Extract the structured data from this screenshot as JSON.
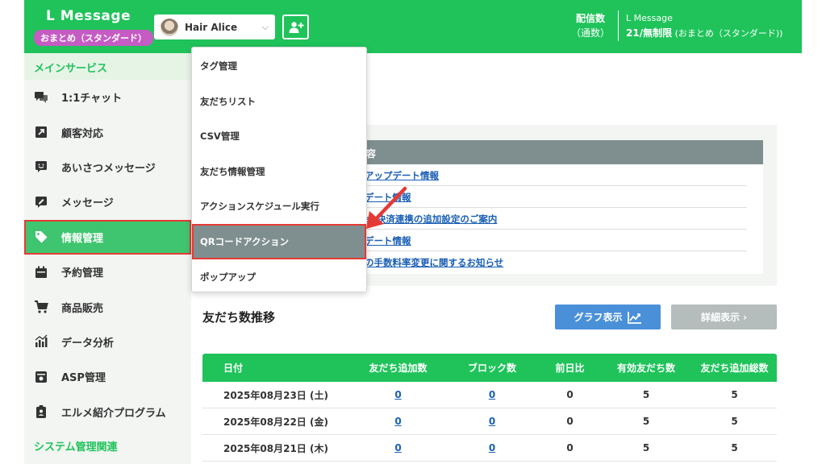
{
  "header": {
    "brand": "L Message",
    "plan_badge": "おまとめ（スタンダード）",
    "account_name": "Hair Alice",
    "delivery_label": "配信数",
    "delivery_sub": "（通数）",
    "plan_name": "L Message",
    "plan_quota": "21/無制限",
    "plan_type": " (おまとめ（スタンダード))"
  },
  "sidebar": {
    "section_main": "メインサービス",
    "items": [
      {
        "label": "1:1チャット",
        "icon": "chat-icon"
      },
      {
        "label": "顧客対応",
        "icon": "external-link-icon"
      },
      {
        "label": "あいさつメッセージ",
        "icon": "smile-message-icon"
      },
      {
        "label": "メッセージ",
        "icon": "message-edit-icon"
      },
      {
        "label": "情報管理",
        "icon": "tag-icon"
      },
      {
        "label": "予約管理",
        "icon": "calendar-icon"
      },
      {
        "label": "商品販売",
        "icon": "cart-icon"
      },
      {
        "label": "データ分析",
        "icon": "bar-chart-icon"
      },
      {
        "label": "ASP管理",
        "icon": "asp-icon"
      },
      {
        "label": "エルメ紹介プログラム",
        "icon": "badge-icon"
      }
    ],
    "section_system": "システム管理関連"
  },
  "dropdown": {
    "items": [
      "タグ管理",
      "友だちリスト",
      "CSV管理",
      "友だち情報管理",
      "アクションスケジュール実行",
      "QRコードアクション",
      "ポップアップ"
    ]
  },
  "notice": {
    "header": "容",
    "links": [
      "アップデート情報",
      "デート情報",
      "ay決済連携の追加設定のご案内",
      "デート情報",
      "の手数料率変更に関するお知らせ"
    ]
  },
  "friends": {
    "title": "友だち数推移",
    "graph_button": "グラフ表示",
    "detail_button": "詳細表示 ›",
    "columns": [
      "日付",
      "友だち追加数",
      "ブロック数",
      "前日比",
      "有効友だち数",
      "友だち追加総数"
    ],
    "rows": [
      [
        "2025年08月23日 (土)",
        "0",
        "0",
        "0",
        "5",
        "5"
      ],
      [
        "2025年08月22日 (金)",
        "0",
        "0",
        "0",
        "5",
        "5"
      ],
      [
        "2025年08月21日 (木)",
        "0",
        "0",
        "0",
        "5",
        "5"
      ]
    ]
  },
  "colors": {
    "brand_green": "#1fc35a",
    "highlight_red": "#e53935",
    "badge_purple": "#c55bc3",
    "link_blue": "#1a5fb4"
  }
}
